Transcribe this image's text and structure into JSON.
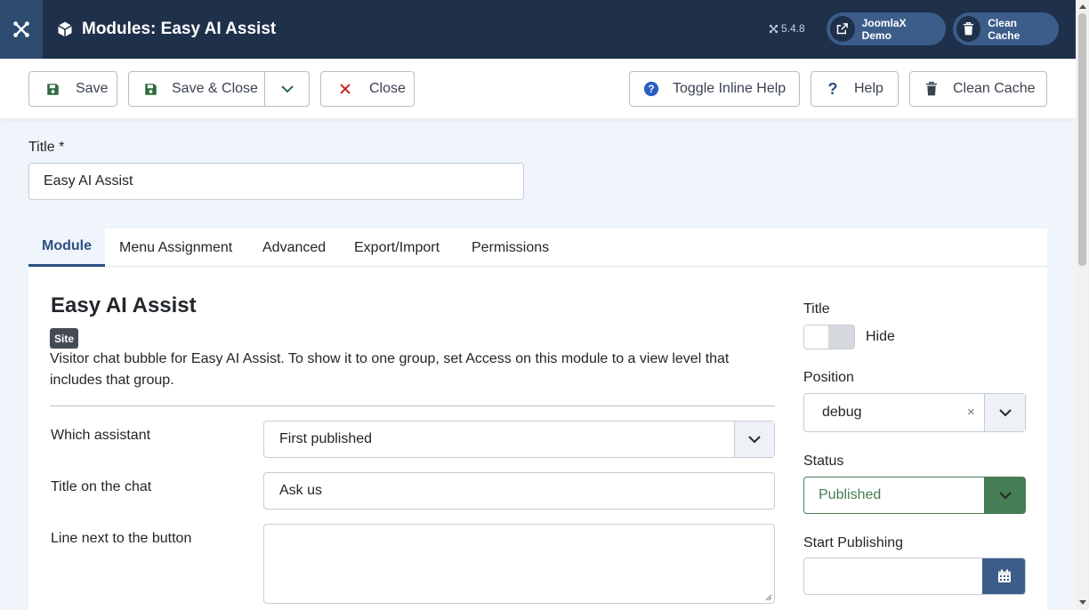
{
  "header": {
    "title": "Modules: Easy AI Assist",
    "version": "5.4.8",
    "site_link_label": "JoomlaX Demo",
    "clean_cache_label": "Clean Cache"
  },
  "toolbar": {
    "save": "Save",
    "save_close": "Save & Close",
    "close": "Close",
    "toggle_help": "Toggle Inline Help",
    "help": "Help",
    "clean_cache": "Clean Cache"
  },
  "title_field": {
    "label": "Title *",
    "value": "Easy AI Assist"
  },
  "tabs": [
    {
      "label": "Module",
      "active": true
    },
    {
      "label": "Menu Assignment",
      "active": false
    },
    {
      "label": "Advanced",
      "active": false
    },
    {
      "label": "Export/Import",
      "active": false
    },
    {
      "label": "Permissions",
      "active": false
    }
  ],
  "module": {
    "heading": "Easy AI Assist",
    "badge": "Site",
    "description": "Visitor chat bubble for Easy AI Assist. To show it to one group, set Access on this module to a view level that includes that group.",
    "fields": {
      "assistant": {
        "label": "Which assistant",
        "value": "First published"
      },
      "chat_title": {
        "label": "Title on the chat",
        "value": "Ask us"
      },
      "button_line": {
        "label": "Line next to the button",
        "value": ""
      }
    }
  },
  "sidebar": {
    "title_label": "Title",
    "title_toggle": "Hide",
    "position_label": "Position",
    "position_value": "debug",
    "position_clear": "×",
    "status_label": "Status",
    "status_value": "Published",
    "start_publishing_label": "Start Publishing",
    "start_publishing_value": ""
  },
  "colors": {
    "header_bg": "#1f304a",
    "accent": "#2a5080",
    "published_green": "#457d54",
    "danger_red": "#c52827",
    "save_green": "#2d6b3f"
  }
}
